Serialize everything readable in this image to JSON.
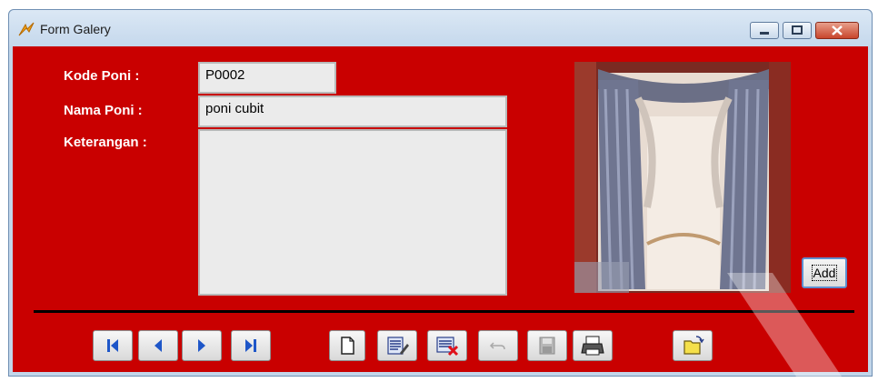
{
  "window": {
    "title": "Form Galery",
    "controls": {
      "minimize": "–",
      "maximize": "□",
      "close": "✕"
    }
  },
  "form": {
    "kode_label": "Kode Poni :",
    "kode_value": "P0002",
    "nama_label": "Nama Poni :",
    "nama_value": "poni cubit",
    "keterangan_label": "Keterangan :",
    "keterangan_value": ""
  },
  "photo": {
    "subject": "curtain-image"
  },
  "buttons": {
    "add_label": "Add",
    "nav": [
      "first-icon",
      "previous-icon",
      "next-icon",
      "last-icon"
    ],
    "actions": [
      "new-icon",
      "edit-icon",
      "delete-icon",
      "undo-icon",
      "save-icon",
      "print-icon",
      "open-folder-icon"
    ]
  },
  "colors": {
    "client_bg": "#c90000",
    "nav_arrow": "#1e56c8",
    "titlebar": "#c5d8ec"
  }
}
